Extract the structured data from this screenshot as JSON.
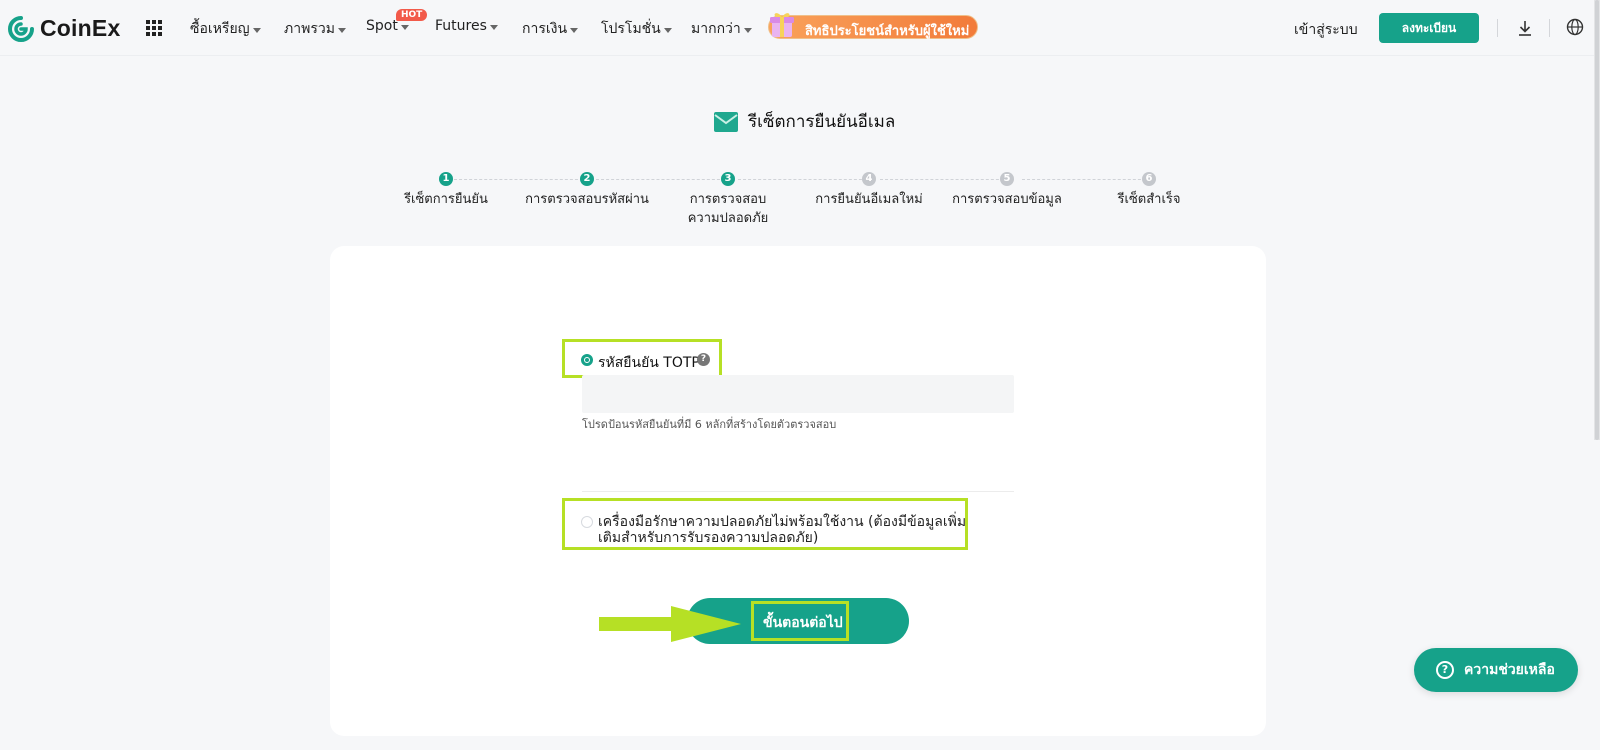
{
  "brand": {
    "name": "CoinEx",
    "accent": "#16a28a"
  },
  "nav": {
    "items": [
      {
        "label": "ซื้อเหรียญ",
        "caret": true
      },
      {
        "label": "ภาพรวม",
        "caret": true
      },
      {
        "label": "Spot",
        "caret": true,
        "badge": "HOT"
      },
      {
        "label": "Futures",
        "caret": true
      },
      {
        "label": "การเงิน",
        "caret": true
      },
      {
        "label": "โปรโมชั่น",
        "caret": true
      },
      {
        "label": "มากกว่า",
        "caret": true
      }
    ],
    "promo_label": "สิทธิประโยชน์สำหรับผู้ใช้ใหม่",
    "login_label": "เข้าสู่ระบบ",
    "signup_label": "ลงทะเบียน",
    "icons": [
      "apps-grid-icon",
      "gift-icon",
      "download-icon",
      "globe-icon"
    ]
  },
  "page": {
    "title": "รีเซ็ตการยืนยันอีเมล",
    "title_icon": "mail-icon"
  },
  "stepper": {
    "steps": [
      {
        "number": "1",
        "label": "รีเซ็ตการยืนยัน",
        "active": true
      },
      {
        "number": "2",
        "label": "การตรวจสอบรหัสผ่าน",
        "active": true
      },
      {
        "number": "3",
        "label": "การตรวจสอบความปลอดภัย",
        "active": true
      },
      {
        "number": "4",
        "label": "การยืนยันอีเมลใหม่",
        "active": false
      },
      {
        "number": "5",
        "label": "การตรวจสอบข้อมูล",
        "active": false
      },
      {
        "number": "6",
        "label": "รีเซ็ตสำเร็จ",
        "active": false
      }
    ]
  },
  "form": {
    "option_totp": {
      "label": "รหัสยืนยัน TOTP",
      "selected": true
    },
    "code_input": {
      "value": "",
      "placeholder": ""
    },
    "hint": "โปรดป้อนรหัสยืนยันที่มี 6 หลักที่สร้างโดยตัวตรวจสอบ",
    "option_unavailable": {
      "label": "เครื่องมือรักษาความปลอดภัยไม่พร้อมใช้งาน (ต้องมีข้อมูลเพิ่มเติมสำหรับการรับรองความปลอดภัย)",
      "selected": false
    },
    "next_label": "ขั้นตอนต่อไป"
  },
  "annotation": {
    "highlight_color": "#b6e025"
  },
  "help": {
    "label": "ความช่วยเหลือ"
  }
}
